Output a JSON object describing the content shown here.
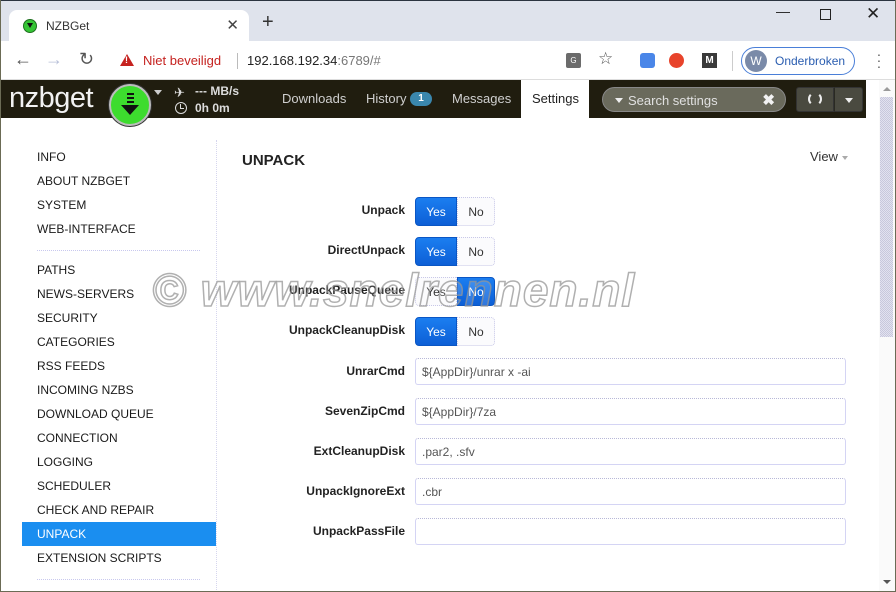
{
  "browser": {
    "tab_title": "NZBGet",
    "security_label": "Niet beveiligd",
    "url_host": "192.168.192.34",
    "url_port_path": ":6789/#",
    "profile_initial": "W",
    "profile_name": "Onderbroken",
    "icons": {
      "back": "arrow-left-icon",
      "forward": "arrow-right-icon",
      "reload": "reload-icon",
      "warning": "warning-triangle-icon",
      "translate": "translate-icon",
      "bookmark": "star-icon",
      "menu": "kebab-menu-icon"
    }
  },
  "app": {
    "logo": "nzbget",
    "speed": "--- MB/s",
    "remaining_time": "0h 0m",
    "nav": {
      "downloads": "Downloads",
      "history": "History",
      "history_badge": "1",
      "messages": "Messages",
      "settings": "Settings"
    },
    "search_placeholder": "Search settings",
    "accent_color": "#1a8ef0"
  },
  "sidebar": {
    "groups": [
      [
        "INFO",
        "ABOUT NZBGET",
        "SYSTEM",
        "WEB-INTERFACE"
      ],
      [
        "PATHS",
        "NEWS-SERVERS",
        "SECURITY",
        "CATEGORIES",
        "RSS FEEDS",
        "INCOMING NZBS",
        "DOWNLOAD QUEUE",
        "CONNECTION",
        "LOGGING",
        "SCHEDULER",
        "CHECK AND REPAIR",
        "UNPACK",
        "EXTENSION SCRIPTS"
      ]
    ],
    "active": "UNPACK"
  },
  "main": {
    "section_title": "UNPACK",
    "view_label": "View",
    "toggles": [
      {
        "label": "Unpack",
        "yes": "Yes",
        "no": "No",
        "value": "Yes"
      },
      {
        "label": "DirectUnpack",
        "yes": "Yes",
        "no": "No",
        "value": "Yes"
      },
      {
        "label": "UnpackPauseQueue",
        "yes": "Yes",
        "no": "No",
        "value": "No"
      },
      {
        "label": "UnpackCleanupDisk",
        "yes": "Yes",
        "no": "No",
        "value": "Yes"
      }
    ],
    "fields": [
      {
        "label": "UnrarCmd",
        "value": "${AppDir}/unrar x -ai"
      },
      {
        "label": "SevenZipCmd",
        "value": "${AppDir}/7za"
      },
      {
        "label": "ExtCleanupDisk",
        "value": ".par2, .sfv"
      },
      {
        "label": "UnpackIgnoreExt",
        "value": ".cbr"
      },
      {
        "label": "UnpackPassFile",
        "value": ""
      }
    ]
  },
  "watermark": "© www.snelrennen.nl"
}
